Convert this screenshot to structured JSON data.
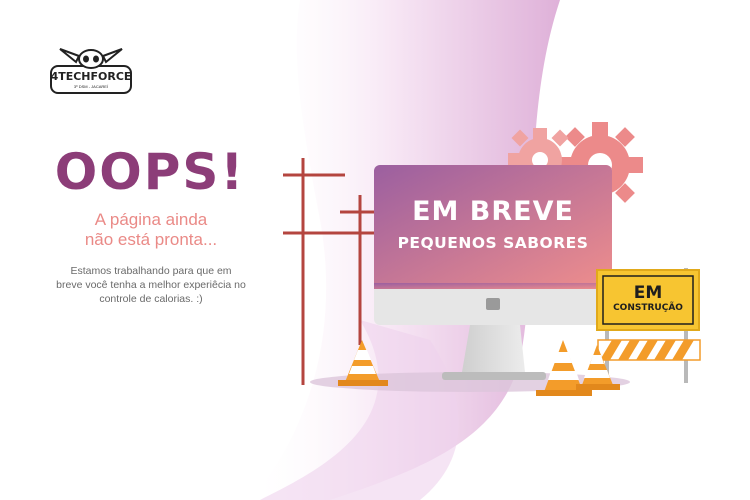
{
  "logo": {
    "name": "4TECHFORCE",
    "tagline": "3º DSM - JACAREÍ"
  },
  "heading": "OOPS!",
  "subtitle_line1": "A página ainda",
  "subtitle_line2": "não está pronta...",
  "description": "Estamos trabalhando para que em breve você tenha a melhor experiêcia no controle de calorias. :)",
  "monitor": {
    "title": "EM BREVE",
    "subtitle": "PEQUENOS SABORES"
  },
  "sign": {
    "line1": "EM",
    "line2": "CONSTRUÇÃO"
  },
  "colors": {
    "heading": "#8c3d78",
    "subtitle": "#ea8a87",
    "accent_gear": "#ec8a8a",
    "screen_gradient_start": "#9b5fa0",
    "screen_gradient_end": "#ef8e8c",
    "sign_yellow": "#f7c531",
    "cone_orange": "#f39c2a"
  }
}
